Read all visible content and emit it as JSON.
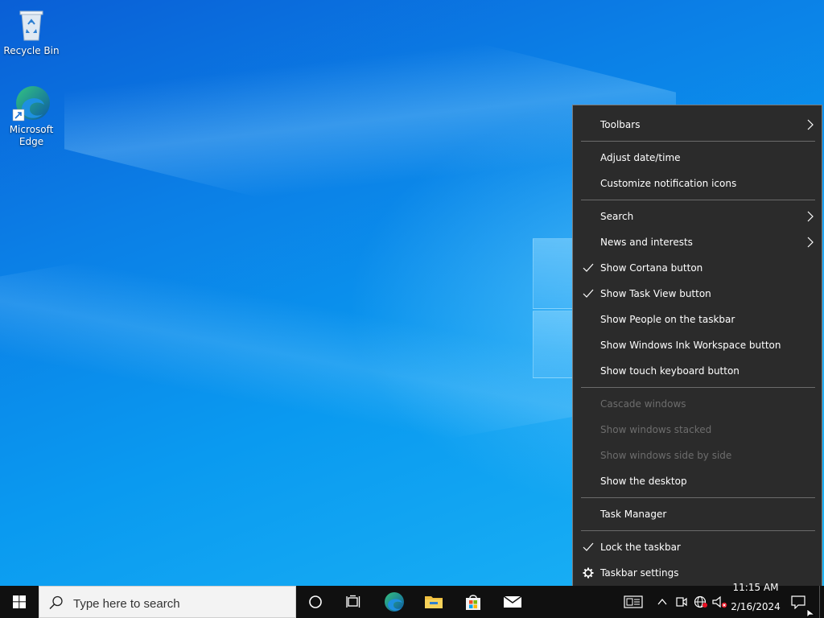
{
  "desktop": {
    "icons": [
      {
        "label": "Recycle Bin",
        "icon": "recycle-bin-icon"
      },
      {
        "label": "Microsoft Edge",
        "icon": "edge-icon"
      }
    ]
  },
  "context_menu": {
    "items": [
      {
        "label": "Toolbars",
        "submenu": true
      },
      {
        "label": "Adjust date/time"
      },
      {
        "label": "Customize notification icons"
      },
      {
        "label": "Search",
        "submenu": true
      },
      {
        "label": "News and interests",
        "submenu": true
      },
      {
        "label": "Show Cortana button",
        "checked": true
      },
      {
        "label": "Show Task View button",
        "checked": true
      },
      {
        "label": "Show People on the taskbar"
      },
      {
        "label": "Show Windows Ink Workspace button"
      },
      {
        "label": "Show touch keyboard button"
      },
      {
        "label": "Cascade windows",
        "disabled": true
      },
      {
        "label": "Show windows stacked",
        "disabled": true
      },
      {
        "label": "Show windows side by side",
        "disabled": true
      },
      {
        "label": "Show the desktop"
      },
      {
        "label": "Task Manager"
      },
      {
        "label": "Lock the taskbar",
        "checked": true
      },
      {
        "label": "Taskbar settings",
        "icon": "gear-icon"
      }
    ]
  },
  "taskbar": {
    "search_placeholder": "Type here to search",
    "pinned": [
      "cortana-icon",
      "task-view-icon",
      "edge-icon",
      "file-explorer-icon",
      "store-icon",
      "mail-icon"
    ],
    "tray": [
      "news-icon",
      "chevron-up-icon",
      "meet-now-icon",
      "network-icon",
      "volume-muted-icon"
    ],
    "clock": {
      "time": "11:15 AM",
      "date": "2/16/2024"
    }
  },
  "colors": {
    "menu_bg": "#2b2b2b",
    "menu_text": "#ffffff",
    "menu_disabled": "#6d6d6d",
    "taskbar_bg": "#101010",
    "accent": "#0078d7"
  }
}
